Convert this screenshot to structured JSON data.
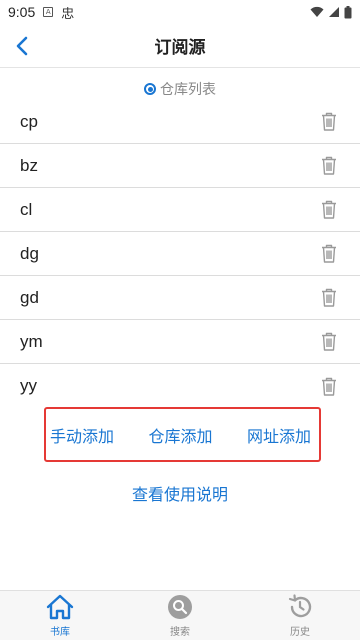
{
  "status": {
    "time": "9:05"
  },
  "header": {
    "title": "订阅源"
  },
  "repo": {
    "label": "仓库列表"
  },
  "sources": [
    "cp",
    "bz",
    "cl",
    "dg",
    "gd",
    "ym",
    "yy"
  ],
  "actions": {
    "manual_add": "手动添加",
    "repo_add": "仓库添加",
    "url_add": "网址添加"
  },
  "help": {
    "label": "查看使用说明"
  },
  "nav": {
    "items": [
      {
        "label": "书库",
        "icon": "home-icon",
        "active": true
      },
      {
        "label": "搜索",
        "icon": "search-icon",
        "active": false
      },
      {
        "label": "历史",
        "icon": "history-icon",
        "active": false
      }
    ]
  },
  "colors": {
    "accent": "#1976d2",
    "highlight_border": "#e53935"
  }
}
